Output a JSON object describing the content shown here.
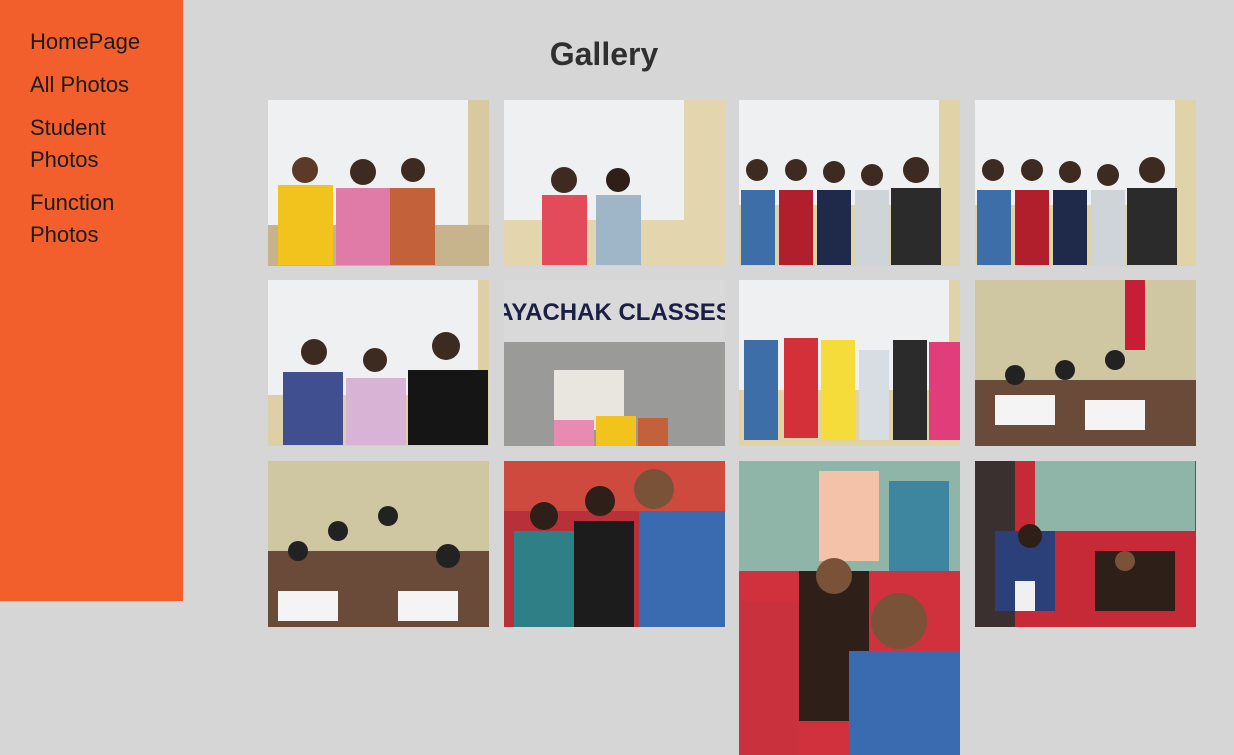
{
  "nav": {
    "items": [
      "HomePage",
      "All Photos",
      "Student Photos",
      "Function Photos"
    ]
  },
  "gallery": {
    "title": "Gallery"
  },
  "colors": {
    "sidebar": "#f25f2c",
    "background": "#d6d6d6",
    "text": "#1b1b1b"
  },
  "photos": {
    "sign": "AYACHAK CLASSES"
  }
}
